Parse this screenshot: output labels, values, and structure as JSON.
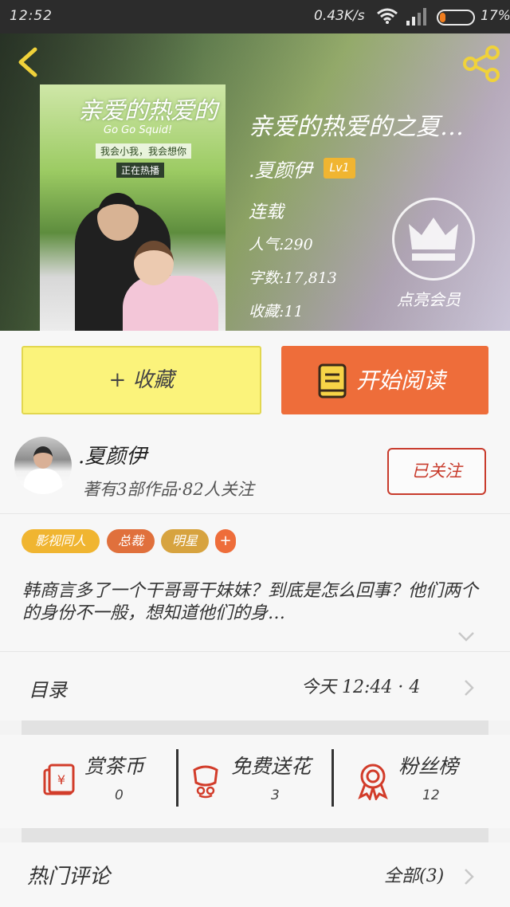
{
  "status_bar": {
    "time": "12:52",
    "net_speed": "0.43K/s",
    "battery_pct": "17%",
    "battery_level": 0.17
  },
  "book": {
    "title": "亲爱的热爱的之夏…",
    "author": ".夏颜伊",
    "level": "Lv1",
    "status": "连载",
    "popularity": "人气:290",
    "word_count": "字数:17,813",
    "favorites": "收藏:11",
    "cover": {
      "title_text": "亲爱的热爱的",
      "subtitle_text": "Go Go Squid!",
      "tagline_text": "我会小我，我会想你",
      "badge_text": "正在热播"
    }
  },
  "vip": {
    "label": "点亮会员"
  },
  "actions": {
    "collect_label": "+ 收藏",
    "read_label": "开始阅读"
  },
  "author_section": {
    "name": ".夏颜伊",
    "meta": "著有3部作品·82人关注",
    "follow_label": "已关注"
  },
  "tags": [
    "影视同人",
    "总裁",
    "明星",
    "+"
  ],
  "description": "韩商言多了一个干哥哥干妹妹？到底是怎么回事？他们两个的身份不一般，想知道他们的身…",
  "catalog": {
    "label": "目录",
    "update": "今天 12:44 · 4"
  },
  "rewards": [
    {
      "label": "赏茶币",
      "value": "0",
      "icon": "red-envelope-icon"
    },
    {
      "label": "免费送花",
      "value": "3",
      "icon": "flower-icon"
    },
    {
      "label": "粉丝榜",
      "value": "12",
      "icon": "medal-icon"
    }
  ],
  "comments": {
    "label": "热门评论",
    "all_label": "全部(3)"
  },
  "colors": {
    "collect_bg": "#fbf37b",
    "read_bg": "#ee6d3a",
    "follow_border": "#c83b2c",
    "level_badge": "#f0b531"
  }
}
